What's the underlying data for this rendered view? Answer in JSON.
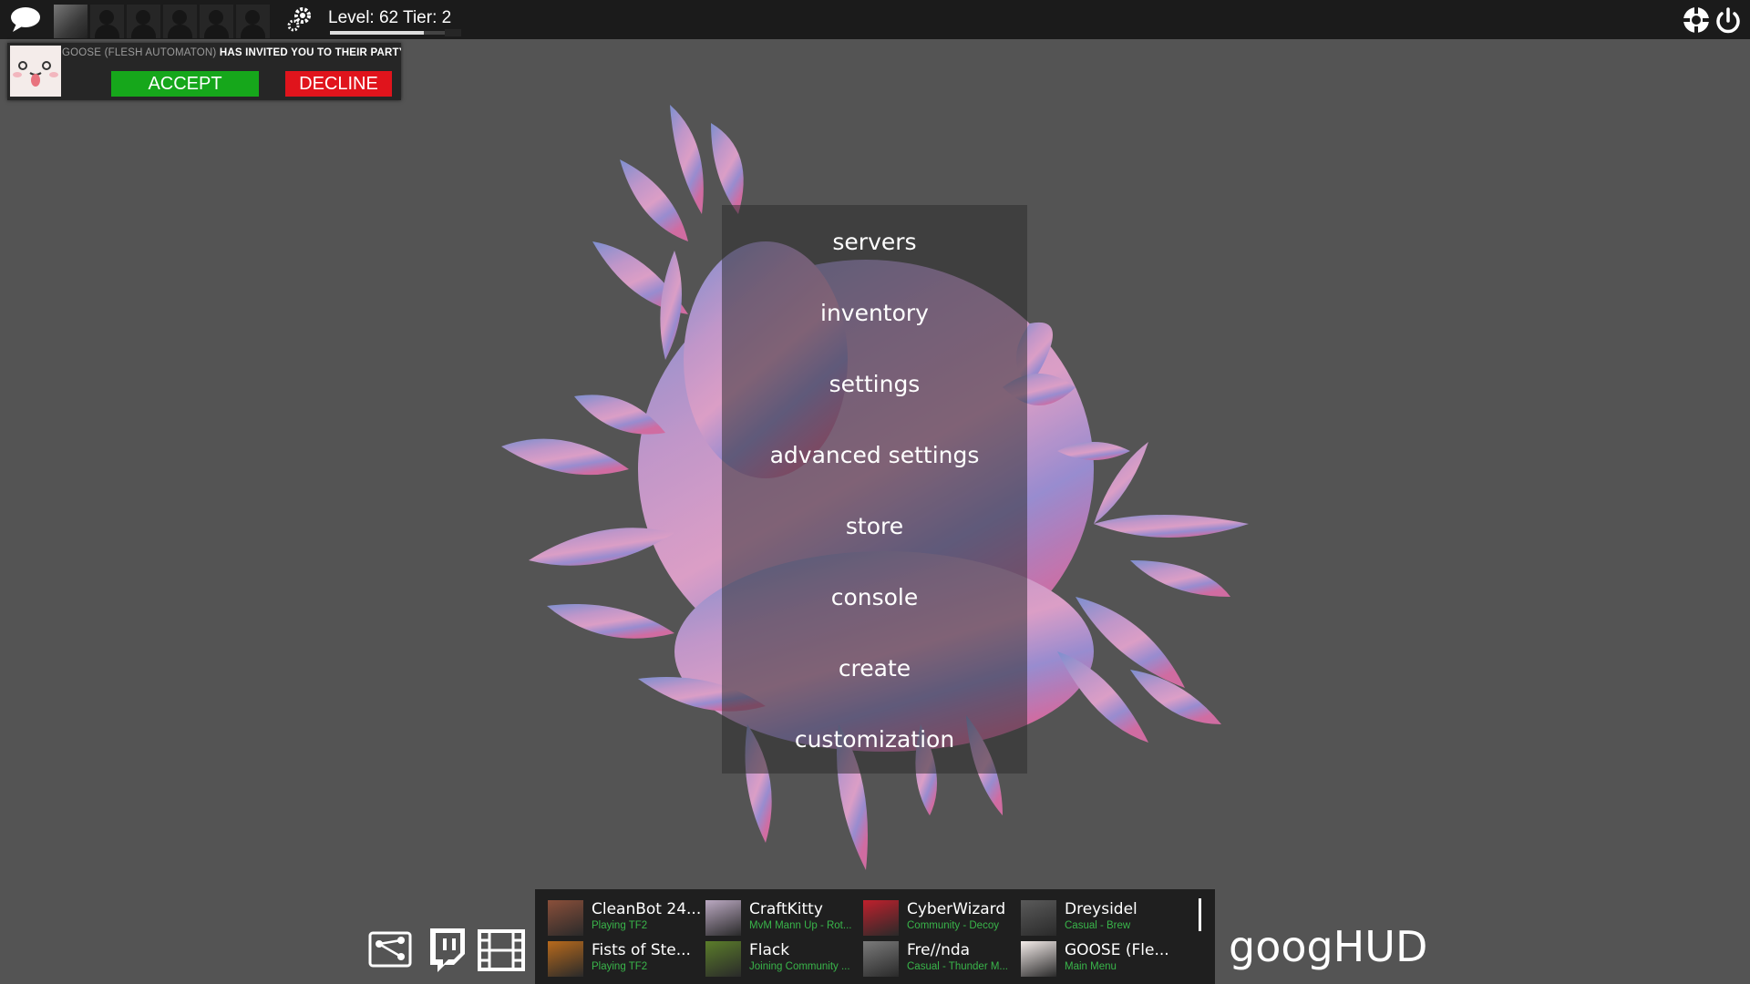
{
  "topbar": {
    "icons": [
      "chat-icon",
      "player-avatar",
      "party-slot",
      "gear-icon",
      "tf2-logo-icon",
      "power-icon"
    ],
    "level_text": "Level: 62 Tier: 2",
    "level_progress": 0.82
  },
  "invite": {
    "inviter_name": "GOOSE (FLESH AUTOMATON)",
    "message": " HAS INVITED YOU TO THEIR PARTY",
    "accept_label": "ACCEPT",
    "decline_label": "DECLINE"
  },
  "menu": {
    "items": [
      "servers",
      "inventory",
      "settings",
      "advanced settings",
      "store",
      "console",
      "create",
      "customization"
    ]
  },
  "bottom": {
    "icons": [
      "share-icon",
      "twitch-icon",
      "film-icon"
    ],
    "brand": "googHUD"
  },
  "friends": [
    {
      "name": "CleanBot 24...",
      "status": "Playing TF2",
      "avatar_color": "#8a4f3a"
    },
    {
      "name": "CraftKitty",
      "status": "MvM Mann Up - Rot...",
      "avatar_color": "#bba9c2"
    },
    {
      "name": "CyberWizard",
      "status": "Community - Decoy",
      "avatar_color": "#c0202c"
    },
    {
      "name": "Dreysidel",
      "status": "Casual - Brew",
      "avatar_color": "#5a5a5a"
    },
    {
      "name": "Fists of Ste...",
      "status": "Playing TF2",
      "avatar_color": "#b86a1c"
    },
    {
      "name": "Flack",
      "status": "Joining Community ...",
      "avatar_color": "#5b7d2a"
    },
    {
      "name": "Fre//nda",
      "status": "Casual - Thunder M...",
      "avatar_color": "#7a7a7a"
    },
    {
      "name": "GOOSE (Fle...",
      "status": "Main Menu",
      "avatar_color": "#f4ecea"
    }
  ],
  "colors": {
    "background": "#545454",
    "accept": "#16a71b",
    "decline": "#e0141c",
    "status_green": "#39b54a"
  }
}
